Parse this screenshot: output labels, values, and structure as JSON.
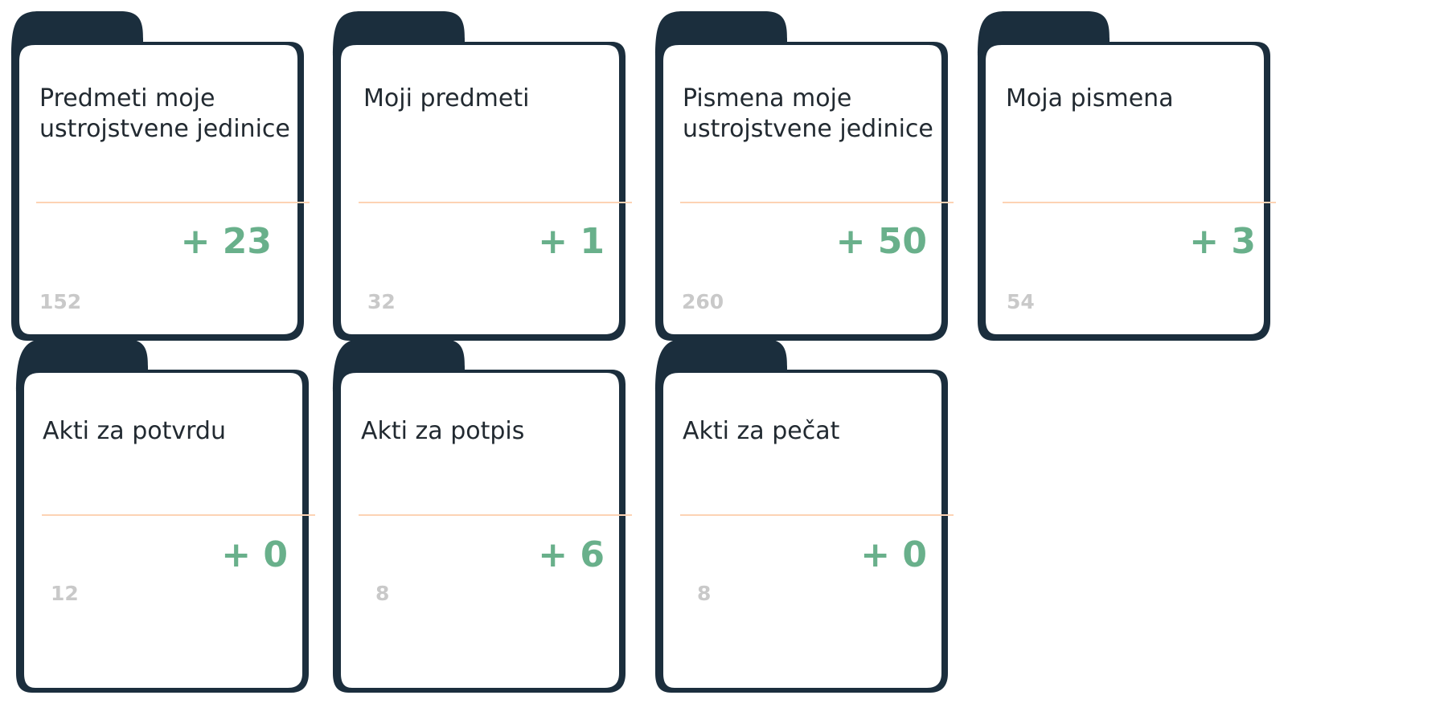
{
  "colors": {
    "folder_outline": "#1b2e3d",
    "folder_fill": "#ffffff",
    "divider": "#fdd3b4",
    "delta_text": "#69b08b",
    "total_text": "#c9c9c9",
    "title_text": "#222a31"
  },
  "cards": [
    {
      "title": "Predmeti moje ustrojstvene jedinice",
      "delta": "+ 23",
      "total": "152"
    },
    {
      "title": "Moji predmeti",
      "delta": "+ 1",
      "total": "32"
    },
    {
      "title": "Pismena moje ustrojstvene jedinice",
      "delta": "+ 50",
      "total": "260"
    },
    {
      "title": "Moja pismena",
      "delta": "+ 3",
      "total": "54"
    },
    {
      "title": "Akti za potvrdu",
      "delta": "+ 0",
      "total": "12"
    },
    {
      "title": "Akti za potpis",
      "delta": "+ 6",
      "total": "8"
    },
    {
      "title": "Akti za pečat",
      "delta": "+ 0",
      "total": "8"
    }
  ]
}
